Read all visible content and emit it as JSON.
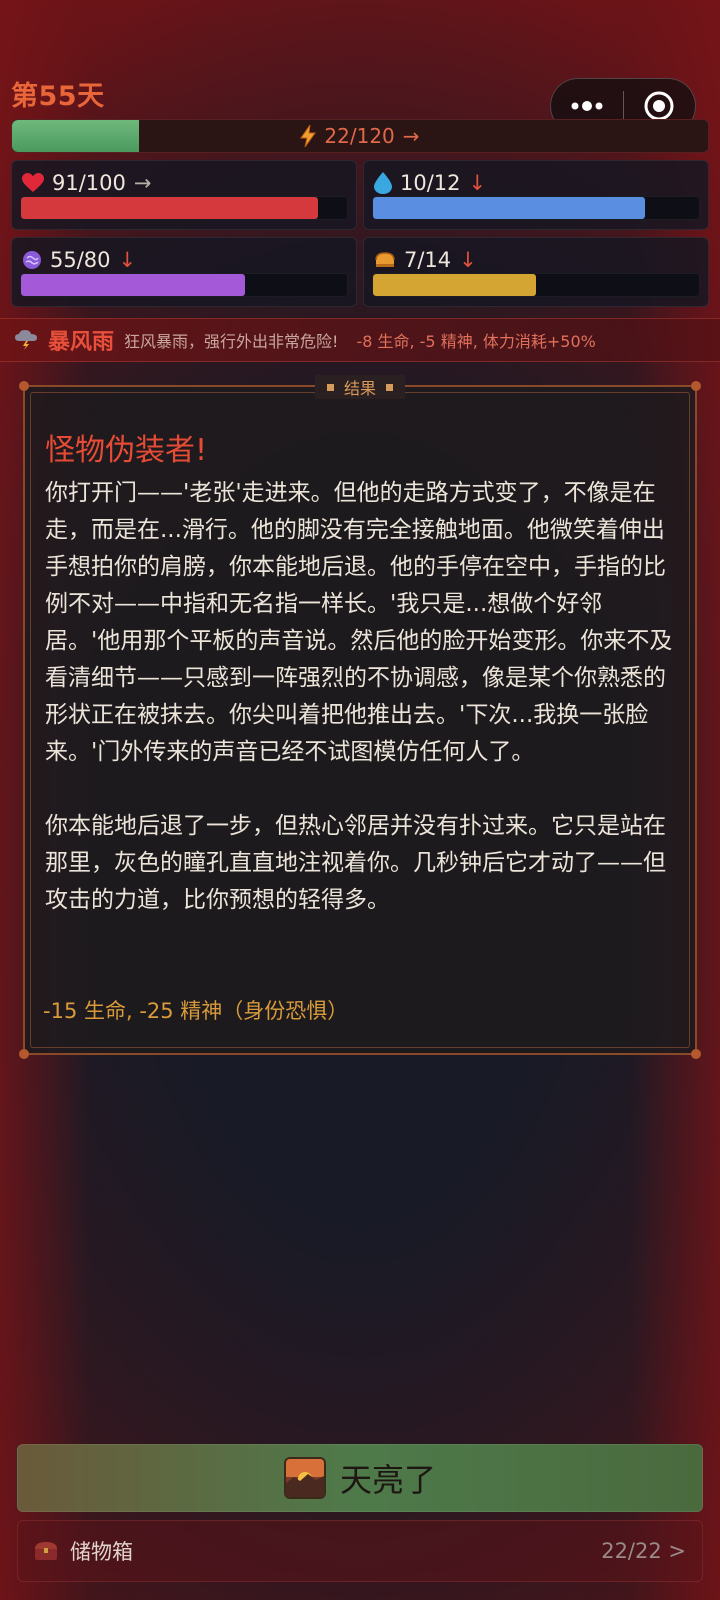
{
  "status": {
    "day": "第55天",
    "energy": {
      "text": "22/120",
      "arrow": "→",
      "fraction": 0.183
    }
  },
  "stats": {
    "health": {
      "text": "91/100",
      "arrow": "→",
      "fraction": 0.91,
      "color": "#d6393d",
      "icon": "heart-icon"
    },
    "water": {
      "text": "10/12",
      "arrow": "↓",
      "fraction": 0.833,
      "color": "#5a8ee0",
      "icon": "water-drop-icon"
    },
    "sanity": {
      "text": "55/80",
      "arrow": "↓",
      "fraction": 0.6875,
      "color": "#a45ad8",
      "icon": "brain-orb-icon"
    },
    "food": {
      "text": "7/14",
      "arrow": "↓",
      "fraction": 0.5,
      "color": "#d4a532",
      "icon": "bread-icon"
    }
  },
  "weather": {
    "name": "暴风雨",
    "description": "狂风暴雨，强行外出非常危险!",
    "effect": "-8 生命, -5 精神, 体力消耗+50%"
  },
  "result": {
    "label": "结果",
    "title": "怪物伪装者!",
    "paragraph1": "你打开门——'老张'走进来。但他的走路方式变了，不像是在走，而是在...滑行。他的脚没有完全接触地面。他微笑着伸出手想拍你的肩膀，你本能地后退。他的手停在空中，手指的比例不对——中指和无名指一样长。'我只是...想做个好邻居。'他用那个平板的声音说。然后他的脸开始变形。你来不及看清细节——只感到一阵强烈的不协调感，像是某个你熟悉的形状正在被抹去。你尖叫着把他推出去。'下次...我换一张脸来。'门外传来的声音已经不试图模仿任何人了。",
    "paragraph2": "你本能地后退了一步，但热心邻居并没有扑过来。它只是站在那里，灰色的瞳孔直直地注视着你。几秒钟后它才动了——但攻击的力道，比你预想的轻得多。",
    "effect": "-15 生命, -25 精神（身份恐惧）"
  },
  "action": {
    "label": "天亮了",
    "icon": "sunrise-icon"
  },
  "storage": {
    "label": "储物箱",
    "count": "22/22 >",
    "icon": "chest-icon"
  },
  "colors": {
    "accent": "#e8663a",
    "danger": "#e54b35",
    "energy_fill": "#5fae6e"
  }
}
